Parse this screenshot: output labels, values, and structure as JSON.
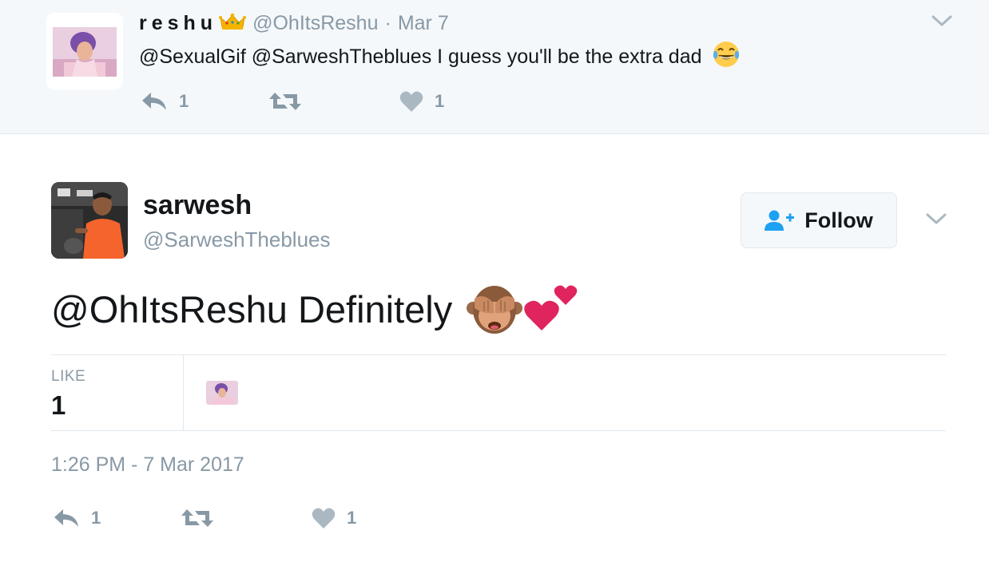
{
  "parent_tweet": {
    "display_name": "reshu",
    "name_badge_icon": "crown-icon",
    "handle": "@OhItsReshu",
    "separator": "·",
    "date": "Mar 7",
    "text": "@SexualGif @SarweshTheblues I guess you'll be the extra dad",
    "text_emoji": "face-with-tears-of-joy",
    "actions": {
      "reply_count": "1",
      "retweet_count": "",
      "like_count": "1"
    }
  },
  "main_tweet": {
    "display_name": "sarwesh",
    "handle": "@SarweshTheblues",
    "follow_button_label": "Follow",
    "text": "@OhItsReshu Definitely",
    "text_emojis": [
      "see-no-evil-monkey",
      "two-hearts"
    ],
    "stats": {
      "likes_label": "LIKE",
      "likes_count": "1"
    },
    "timestamp": "1:26 PM - 7 Mar 2017",
    "actions": {
      "reply_count": "1",
      "retweet_count": "",
      "like_count": "1"
    }
  },
  "colors": {
    "text_primary": "#14171a",
    "text_secondary": "#8899a6",
    "parent_background": "#f5f8fa",
    "border": "#e1e8ed",
    "follow_icon": "#1da1f2",
    "heart": "#e0245e"
  }
}
